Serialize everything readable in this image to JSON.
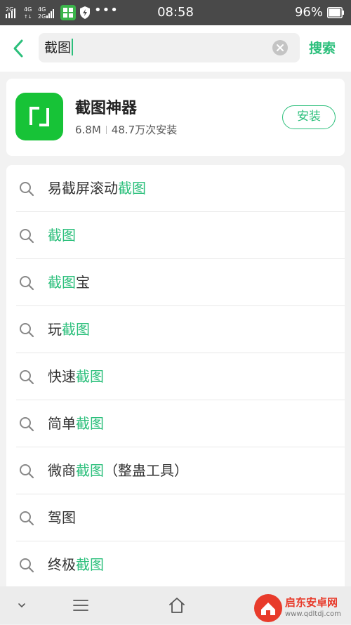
{
  "status_bar": {
    "signal_1": "2G",
    "signal_2": "4G",
    "signal_3": "4G",
    "signal_4": "2G",
    "time": "08:58",
    "battery": "96%",
    "battery_level": 0.96
  },
  "search": {
    "back_icon": "chevron-left-icon",
    "query": "截图",
    "clear_icon": "clear-circle-icon",
    "button_label": "搜索"
  },
  "app_card": {
    "name": "截图神器",
    "size": "6.8M",
    "installs": "48.7万次安装",
    "install_label": "安装",
    "icon_color": "#17c337"
  },
  "suggestions": [
    {
      "prefix": "易截屏滚动",
      "highlight": "截图",
      "suffix": ""
    },
    {
      "prefix": "",
      "highlight": "截图",
      "suffix": ""
    },
    {
      "prefix": "",
      "highlight": "截图",
      "suffix": "宝"
    },
    {
      "prefix": "玩",
      "highlight": "截图",
      "suffix": ""
    },
    {
      "prefix": "快速",
      "highlight": "截图",
      "suffix": ""
    },
    {
      "prefix": "简单",
      "highlight": "截图",
      "suffix": ""
    },
    {
      "prefix": "微商",
      "highlight": "截图",
      "suffix": "（整蛊工具）"
    },
    {
      "prefix": "驾图",
      "highlight": "",
      "suffix": ""
    },
    {
      "prefix": "终极",
      "highlight": "截图",
      "suffix": ""
    }
  ],
  "bottom_nav": {
    "items": [
      "chevron-down-icon",
      "menu-icon",
      "home-icon"
    ]
  },
  "watermark": {
    "title": "启东安卓网",
    "url": "www.qdltdj.com"
  },
  "colors": {
    "accent": "#2bbf7b",
    "status_bar": "#494949"
  }
}
